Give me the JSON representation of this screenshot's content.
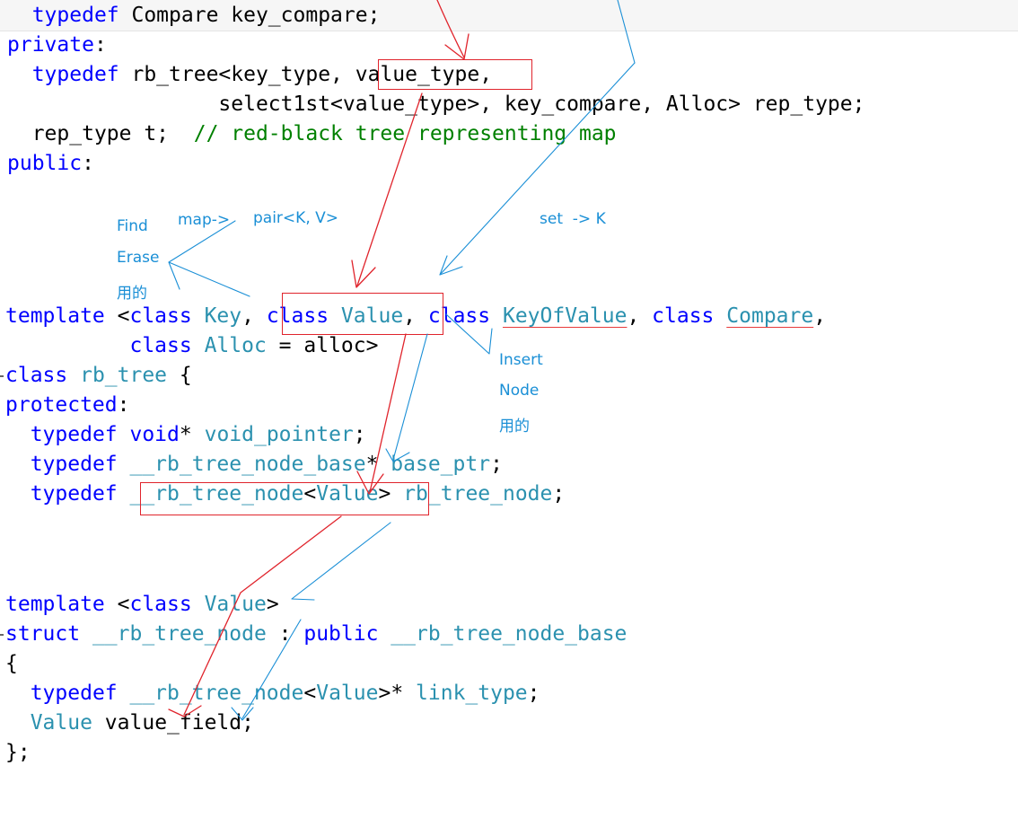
{
  "top_code": {
    "line1": {
      "kw": "typedef",
      "text": " Compare key_compare;"
    },
    "line2": {
      "kw": "private",
      "colon": ":"
    },
    "line3": {
      "kw": "typedef",
      "pre": " rb_tree<key_type, ",
      "boxed": "value_type",
      "post": ","
    },
    "line4": {
      "text": "select1st<value_type>, key_compare, Alloc> rep_type;"
    },
    "line5": {
      "text": "rep_type t;  ",
      "comment": "// red-black tree representing map"
    },
    "line6": {
      "kw": "public",
      "colon": ":"
    }
  },
  "rb_tree_code": {
    "template_line": {
      "kw_template": "template",
      "t1": " <",
      "kw_class1": "class",
      "type_key": " Key",
      "t2": ", ",
      "kw_class2": "class",
      "type_value": " Value",
      "t3": ", ",
      "kw_class3": "class",
      "type_keyofvalue": "KeyOfValue",
      "t4": ", ",
      "kw_class4": "class",
      "type_compare": "Compare",
      "t5": ","
    },
    "alloc_line": {
      "kw_class": "class",
      "type_alloc": " Alloc",
      "rest": " = alloc>"
    },
    "class_line": {
      "kw": "class",
      "name": " rb_tree",
      "rest": " {"
    },
    "protected_line": {
      "kw": "protected",
      "colon": ":"
    },
    "void_pointer_line": {
      "kw": "typedef",
      "kw2": " void",
      "star": "* ",
      "name": "void_pointer",
      "semi": ";"
    },
    "base_ptr_line": {
      "kw": "typedef",
      "type": " __rb_tree_node_base",
      "star": "* ",
      "name": "base_ptr",
      "semi": ";"
    },
    "rb_tree_node_line": {
      "kw": "typedef",
      "sp": " ",
      "type": "__rb_tree_node",
      "lt": "<",
      "arg": "Value",
      "gt": ">",
      "sp2": " ",
      "name": "rb_tree_node",
      "semi": ";"
    }
  },
  "node_code": {
    "template_line": {
      "kw_template": "template",
      "t1": " <",
      "kw_class": "class",
      "type_value": " Value",
      "t2": ">"
    },
    "struct_line": {
      "kw_struct": "struct",
      "name": " __rb_tree_node",
      "t1": " : ",
      "kw_public": "public",
      "base": " __rb_tree_node_base"
    },
    "open_brace": "{",
    "link_type_line": {
      "kw": "typedef",
      "type": " __rb_tree_node",
      "lt": "<",
      "arg": "Value",
      "gt": ">",
      "star": "* ",
      "name": "link_type",
      "semi": ";"
    },
    "value_field_line": {
      "type": "Value",
      "name": " value_field",
      "semi": ";"
    },
    "close_brace": "};"
  },
  "annotations": {
    "find": "Find",
    "erase": "Erase",
    "yongde_left": "用的",
    "map_arrow": "map->",
    "pair": "pair<K, V>",
    "set": "set  -> K",
    "insert": "Insert",
    "node": "Node",
    "yongde_right": "用的"
  },
  "colors": {
    "keyword": "#0000ff",
    "type": "#2b91af",
    "comment": "#008000",
    "annotation_blue": "#1a8fd6",
    "annotation_red": "#e0242c"
  }
}
